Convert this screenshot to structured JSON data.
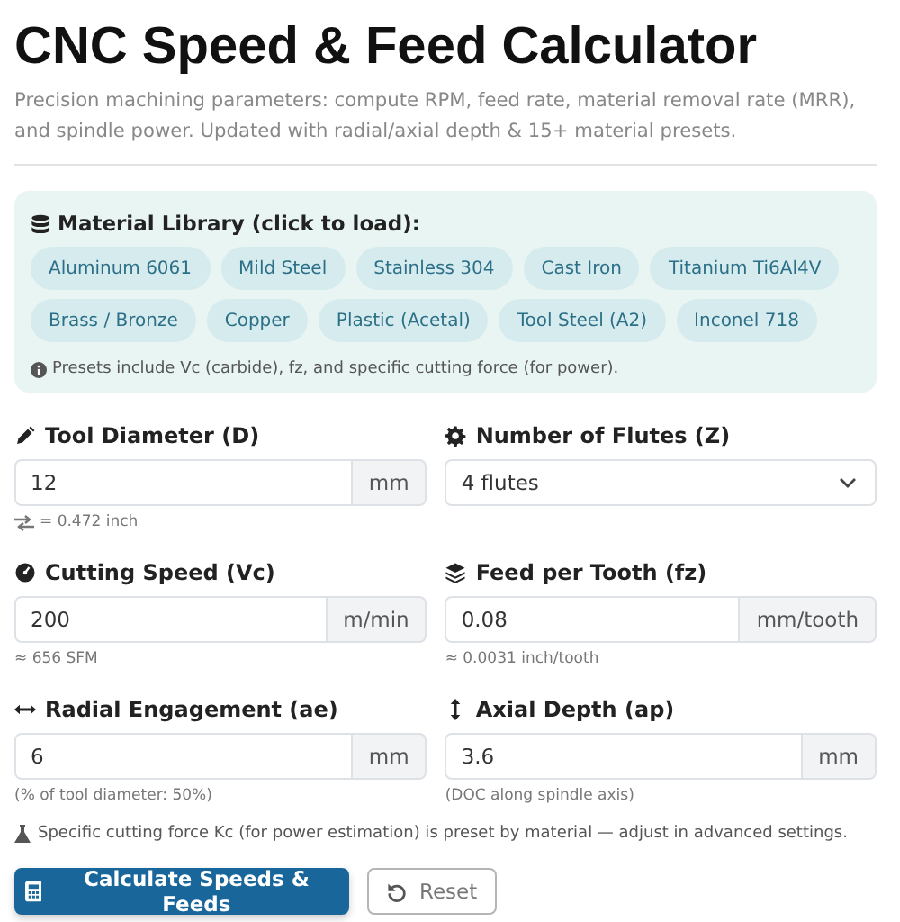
{
  "title": "CNC Speed & Feed Calculator",
  "subtitle": "Precision machining parameters: compute RPM, feed rate, material removal rate (MRR), and spindle power. Updated with radial/axial depth & 15+ material presets.",
  "library": {
    "heading": "Material Library (click to load):",
    "presets": [
      {
        "label": "Aluminum 6061"
      },
      {
        "label": "Mild Steel"
      },
      {
        "label": "Stainless 304"
      },
      {
        "label": "Cast Iron"
      },
      {
        "label": "Titanium Ti6Al4V"
      },
      {
        "label": "Brass / Bronze"
      },
      {
        "label": "Copper"
      },
      {
        "label": "Plastic (Acetal)"
      },
      {
        "label": "Tool Steel (A2)"
      },
      {
        "label": "Inconel 718"
      }
    ],
    "note": "Presets include Vc (carbide), fz, and specific cutting force (for power)."
  },
  "fields": [
    {
      "kind": "input",
      "label": "Tool Diameter (D)",
      "value": "12",
      "unit": "mm",
      "hint": "= 0.472 inch"
    },
    {
      "kind": "select",
      "label": "Number of Flutes (Z)",
      "value": "4 flutes"
    },
    {
      "kind": "input",
      "label": "Cutting Speed (Vc)",
      "value": "200",
      "unit": "m/min",
      "hint": "≈ 656 SFM"
    },
    {
      "kind": "input",
      "label": "Feed per Tooth (fz)",
      "value": "0.08",
      "unit": "mm/tooth",
      "hint": "≈ 0.0031 inch/tooth"
    },
    {
      "kind": "input",
      "label": "Radial Engagement (ae)",
      "value": "6",
      "unit": "mm",
      "hint": "(% of tool diameter: 50%)"
    },
    {
      "kind": "input",
      "label": "Axial Depth (ap)",
      "value": "3.6",
      "unit": "mm",
      "hint": "(DOC along spindle axis)"
    }
  ],
  "note": "Specific cutting force Kc (for power estimation) is preset by material — adjust in advanced settings.",
  "buttons": [
    {
      "kind": "primary",
      "label": "Calculate Speeds & Feeds"
    },
    {
      "kind": "secondary",
      "label": "Reset"
    }
  ]
}
